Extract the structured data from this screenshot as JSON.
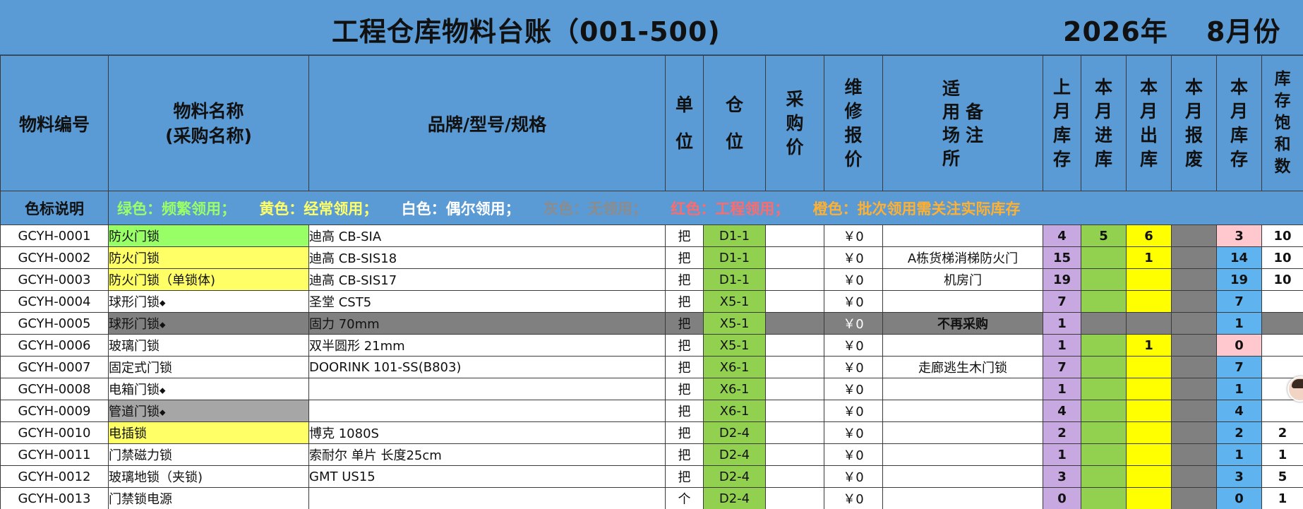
{
  "title": {
    "main": "工程仓库物料台账（001-500)",
    "year": "2026年",
    "month": "8月份"
  },
  "headers": {
    "code": "物料编号",
    "name_line1": "物料名称",
    "name_line2": "(采购名称)",
    "spec": "品牌/型号/规格",
    "unit": [
      "单",
      "位"
    ],
    "location": [
      "仓",
      "位"
    ],
    "purchase_price": [
      "采",
      "购",
      "价"
    ],
    "repair_price": [
      "维",
      "修",
      "报",
      "价"
    ],
    "usage": [
      "适",
      "用",
      "场",
      "所"
    ],
    "remark": [
      "备",
      "注"
    ],
    "last_stock": [
      "上",
      "月",
      "库",
      "存"
    ],
    "in": [
      "本",
      "月",
      "进",
      "库"
    ],
    "out": [
      "本",
      "月",
      "出",
      "库"
    ],
    "scrap": [
      "本",
      "月",
      "报",
      "废"
    ],
    "stock": [
      "本",
      "月",
      "库",
      "存"
    ],
    "saturation": [
      "库",
      "存",
      "饱",
      "和",
      "数"
    ]
  },
  "legend": {
    "label": "色标说明",
    "items": [
      {
        "text": "绿色：频繁领用；",
        "color": "#99ff66"
      },
      {
        "text": "黄色：经常领用；",
        "color": "#ffff66"
      },
      {
        "text": "白色：偶尔领用；",
        "color": "#ffffff"
      },
      {
        "text": "灰色：无领用；",
        "color": "#8c8c8c"
      },
      {
        "text": "红色：工程领用；",
        "color": "#ff6b6b"
      },
      {
        "text": "橙色：批次领用需关注实际库存",
        "color": "#ffb030"
      }
    ]
  },
  "colors": {
    "header_blue": "#5b9bd5",
    "frequent": "#99ff66",
    "regular": "#ffff66",
    "none": "#a6a6a6",
    "discontinued_row": "#808080",
    "last_stock": "#c8a8e0",
    "in": "#92d050",
    "out": "#ffff00",
    "scrap": "#808080",
    "stock": "#5fb4ef",
    "stock_low": "#ffc7ce"
  },
  "rows": [
    {
      "code": "GCYH-0001",
      "name": "防火门锁",
      "diamond": false,
      "name_bg": "bg-green",
      "spec": "迪高 CB-SIA",
      "unit": "把",
      "loc": "D1-1",
      "repair": "￥0",
      "usage": "",
      "last": "4",
      "in": "5",
      "out": "6",
      "stock": "3",
      "stock_low": true,
      "sat": "10"
    },
    {
      "code": "GCYH-0002",
      "name": "防火门锁",
      "diamond": false,
      "name_bg": "bg-yellow",
      "spec": "迪高 CB-SIS18",
      "unit": "把",
      "loc": "D1-1",
      "repair": "￥0",
      "usage": "A栋货梯消梯防火门",
      "last": "15",
      "in": "",
      "out": "1",
      "stock": "14",
      "stock_low": false,
      "sat": "10"
    },
    {
      "code": "GCYH-0003",
      "name": "防火门锁（单锁体)",
      "diamond": false,
      "name_bg": "bg-yellow",
      "spec": "迪高 CB-SIS17",
      "unit": "把",
      "loc": "D1-1",
      "repair": "￥0",
      "usage": "机房门",
      "last": "19",
      "in": "",
      "out": "",
      "stock": "19",
      "stock_low": false,
      "sat": "10"
    },
    {
      "code": "GCYH-0004",
      "name": "球形门锁",
      "diamond": true,
      "name_bg": "",
      "spec": "圣堂 CST5",
      "unit": "把",
      "loc": "X5-1",
      "repair": "￥0",
      "usage": "",
      "last": "7",
      "in": "",
      "out": "",
      "stock": "7",
      "stock_low": false,
      "sat": ""
    },
    {
      "code": "GCYH-0005",
      "name": "球形门锁",
      "diamond": true,
      "name_bg": "",
      "spec": "固力 70mm",
      "unit": "把",
      "loc": "X5-1",
      "repair": "￥0",
      "usage": "不再采购",
      "last": "1",
      "in": "",
      "out": "",
      "stock": "1",
      "stock_low": false,
      "sat": "",
      "discontinued": true
    },
    {
      "code": "GCYH-0006",
      "name": "玻璃门锁",
      "diamond": false,
      "name_bg": "",
      "spec": "双半圆形 21mm",
      "unit": "把",
      "loc": "X5-1",
      "repair": "￥0",
      "usage": "",
      "last": "1",
      "in": "",
      "out": "1",
      "stock": "0",
      "stock_low": true,
      "sat": ""
    },
    {
      "code": "GCYH-0007",
      "name": "固定式门锁",
      "diamond": false,
      "name_bg": "",
      "spec": "DOORINK 101-SS(B803)",
      "unit": "把",
      "loc": "X6-1",
      "repair": "￥0",
      "usage": "走廊逃生木门锁",
      "last": "7",
      "in": "",
      "out": "",
      "stock": "7",
      "stock_low": false,
      "sat": ""
    },
    {
      "code": "GCYH-0008",
      "name": "电箱门锁",
      "diamond": true,
      "name_bg": "",
      "spec": "",
      "unit": "把",
      "loc": "X6-1",
      "repair": "￥0",
      "usage": "",
      "last": "1",
      "in": "",
      "out": "",
      "stock": "1",
      "stock_low": false,
      "sat": ""
    },
    {
      "code": "GCYH-0009",
      "name": "管道门锁",
      "diamond": true,
      "name_bg": "bg-grey",
      "spec": "",
      "unit": "把",
      "loc": "X6-1",
      "repair": "￥0",
      "usage": "",
      "last": "4",
      "in": "",
      "out": "",
      "stock": "4",
      "stock_low": false,
      "sat": ""
    },
    {
      "code": "GCYH-0010",
      "name": "电插锁",
      "diamond": false,
      "name_bg": "bg-yellow",
      "spec": "博克 1080S",
      "unit": "把",
      "loc": "D2-4",
      "repair": "￥0",
      "usage": "",
      "last": "2",
      "in": "",
      "out": "",
      "stock": "2",
      "stock_low": false,
      "sat": "2"
    },
    {
      "code": "GCYH-0011",
      "name": "门禁磁力锁",
      "diamond": false,
      "name_bg": "",
      "spec": "索耐尔 单片 长度25cm",
      "unit": "把",
      "loc": "D2-4",
      "repair": "￥0",
      "usage": "",
      "last": "1",
      "in": "",
      "out": "",
      "stock": "1",
      "stock_low": false,
      "sat": "1"
    },
    {
      "code": "GCYH-0012",
      "name": "玻璃地锁（夹锁)",
      "diamond": false,
      "name_bg": "",
      "spec": "GMT US15",
      "unit": "把",
      "loc": "D2-4",
      "repair": "￥0",
      "usage": "",
      "last": "3",
      "in": "",
      "out": "",
      "stock": "3",
      "stock_low": false,
      "sat": "5"
    },
    {
      "code": "GCYH-0013",
      "name": "门禁锁电源",
      "diamond": false,
      "name_bg": "",
      "spec": "",
      "unit": "个",
      "loc": "D2-4",
      "repair": "￥0",
      "usage": "",
      "last": "0",
      "in": "",
      "out": "",
      "stock": "0",
      "stock_low": false,
      "sat": "1"
    }
  ]
}
